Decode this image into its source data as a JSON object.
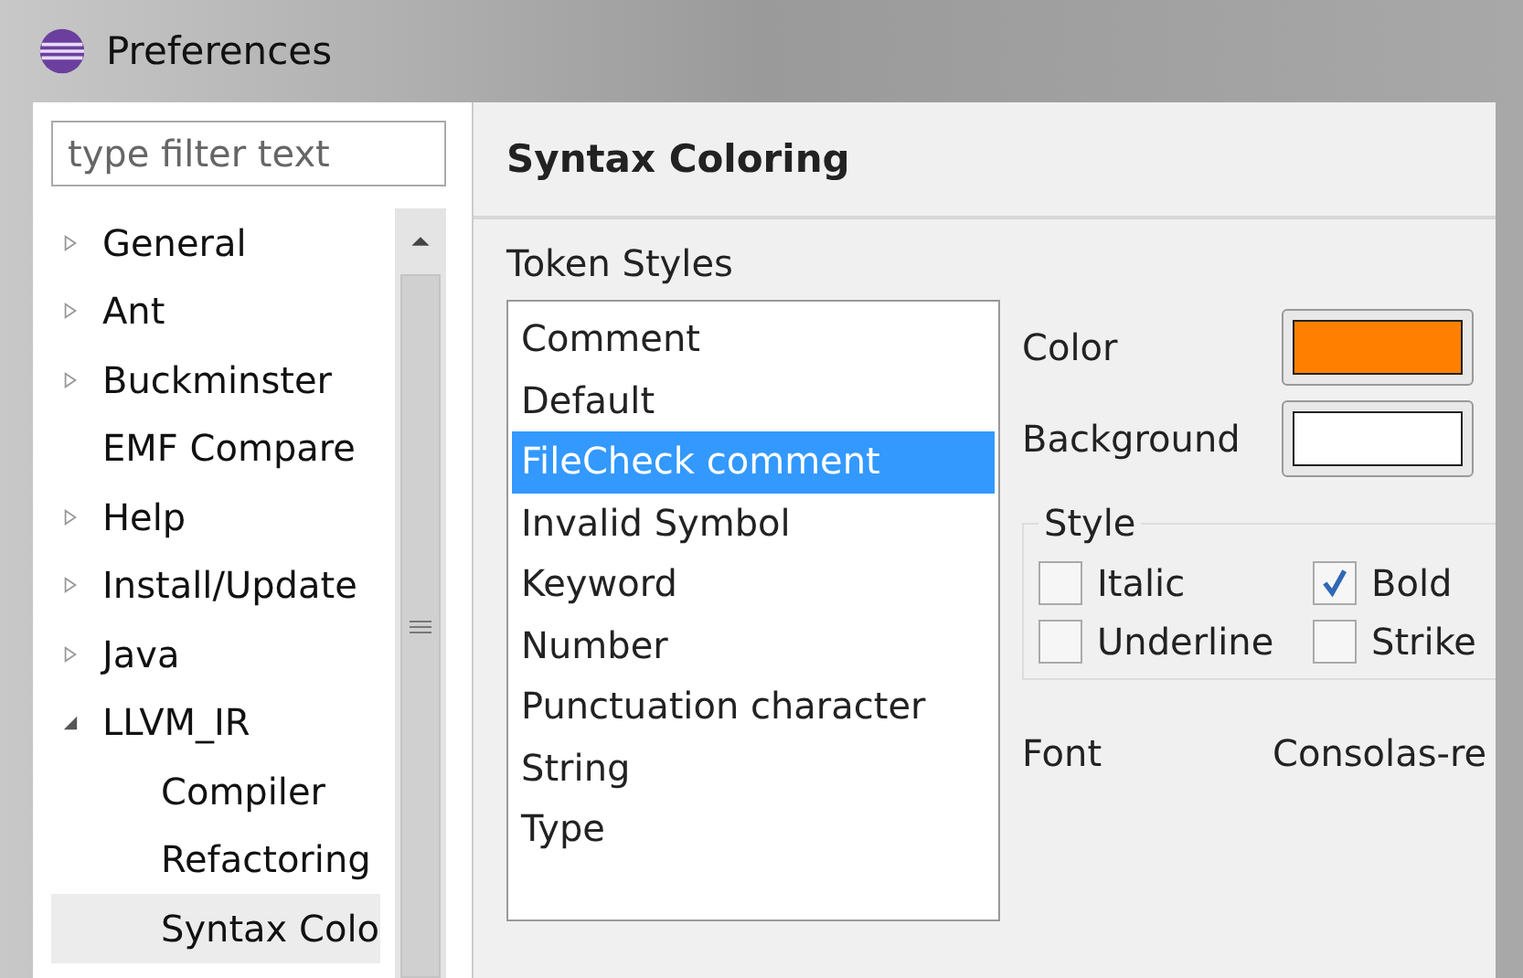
{
  "window": {
    "title": "Preferences"
  },
  "filter": {
    "placeholder": "type filter text"
  },
  "tree": [
    {
      "label": "General",
      "kind": "branch",
      "expanded": false,
      "selected": false
    },
    {
      "label": "Ant",
      "kind": "branch",
      "expanded": false,
      "selected": false
    },
    {
      "label": "Buckminster",
      "kind": "branch",
      "expanded": false,
      "selected": false
    },
    {
      "label": "EMF Compare",
      "kind": "leaf",
      "selected": false
    },
    {
      "label": "Help",
      "kind": "branch",
      "expanded": false,
      "selected": false
    },
    {
      "label": "Install/Update",
      "kind": "branch",
      "expanded": false,
      "selected": false
    },
    {
      "label": "Java",
      "kind": "branch",
      "expanded": false,
      "selected": false
    },
    {
      "label": "LLVM_IR",
      "kind": "branch",
      "expanded": true,
      "selected": false,
      "children": [
        {
          "label": "Compiler",
          "selected": false
        },
        {
          "label": "Refactoring",
          "selected": false
        },
        {
          "label": "Syntax Colo",
          "selected": true
        }
      ]
    }
  ],
  "page": {
    "title": "Syntax Coloring",
    "token_styles_label": "Token Styles",
    "tokens": [
      {
        "label": "Comment",
        "selected": false
      },
      {
        "label": "Default",
        "selected": false
      },
      {
        "label": "FileCheck comment",
        "selected": true
      },
      {
        "label": "Invalid Symbol",
        "selected": false
      },
      {
        "label": "Keyword",
        "selected": false
      },
      {
        "label": "Number",
        "selected": false
      },
      {
        "label": "Punctuation character",
        "selected": false
      },
      {
        "label": "String",
        "selected": false
      },
      {
        "label": "Type",
        "selected": false
      }
    ],
    "color": {
      "label": "Color",
      "color": "#ff8000"
    },
    "background": {
      "label": "Background",
      "color": "#ffffff"
    },
    "style": {
      "label": "Style",
      "options": [
        {
          "label": "Italic",
          "checked": false
        },
        {
          "label": "Bold",
          "checked": true
        },
        {
          "label": "Underline",
          "checked": false
        },
        {
          "label": "Strike",
          "checked": false
        }
      ]
    },
    "font": {
      "label": "Font",
      "value": "Consolas-re"
    }
  }
}
